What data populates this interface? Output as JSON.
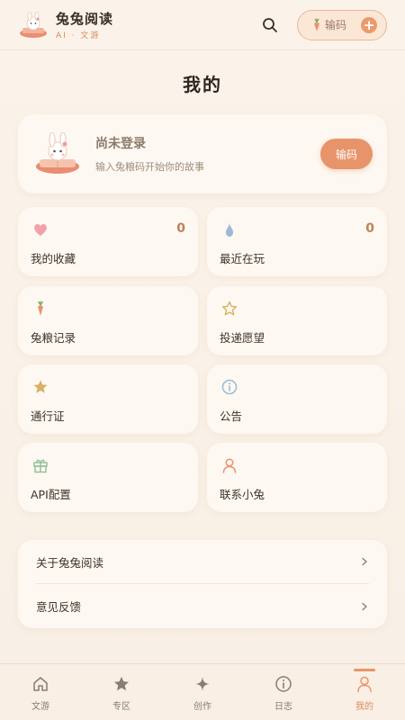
{
  "header": {
    "brand_name": "兔兔阅读",
    "brand_sub": "AI · 文游",
    "code_pill_label": "输码"
  },
  "page_title": "我的",
  "profile": {
    "title": "尚未登录",
    "subtitle": "输入兔粮码开始你的故事",
    "login_button": "输码"
  },
  "tiles": [
    {
      "label": "我的收藏",
      "count": "0",
      "icon": "heart-icon"
    },
    {
      "label": "最近在玩",
      "count": "0",
      "icon": "droplet-icon"
    },
    {
      "label": "兔粮记录",
      "icon": "carrot-icon"
    },
    {
      "label": "投递愿望",
      "icon": "star-outline-icon"
    },
    {
      "label": "通行证",
      "icon": "star-icon"
    },
    {
      "label": "公告",
      "icon": "info-icon"
    },
    {
      "label": "API配置",
      "icon": "gift-icon"
    },
    {
      "label": "联系小兔",
      "icon": "user-icon"
    }
  ],
  "menu": [
    {
      "label": "关于兔兔阅读"
    },
    {
      "label": "意见反馈"
    }
  ],
  "tabbar": [
    {
      "label": "文游",
      "icon": "home-icon"
    },
    {
      "label": "专区",
      "icon": "star-icon"
    },
    {
      "label": "创作",
      "icon": "sparkle-icon"
    },
    {
      "label": "日志",
      "icon": "info-icon"
    },
    {
      "label": "我的",
      "icon": "user-icon",
      "active": true
    }
  ],
  "colors": {
    "accent": "#e8946a",
    "background": "#fbf3ea",
    "card": "#fdf8f1"
  }
}
